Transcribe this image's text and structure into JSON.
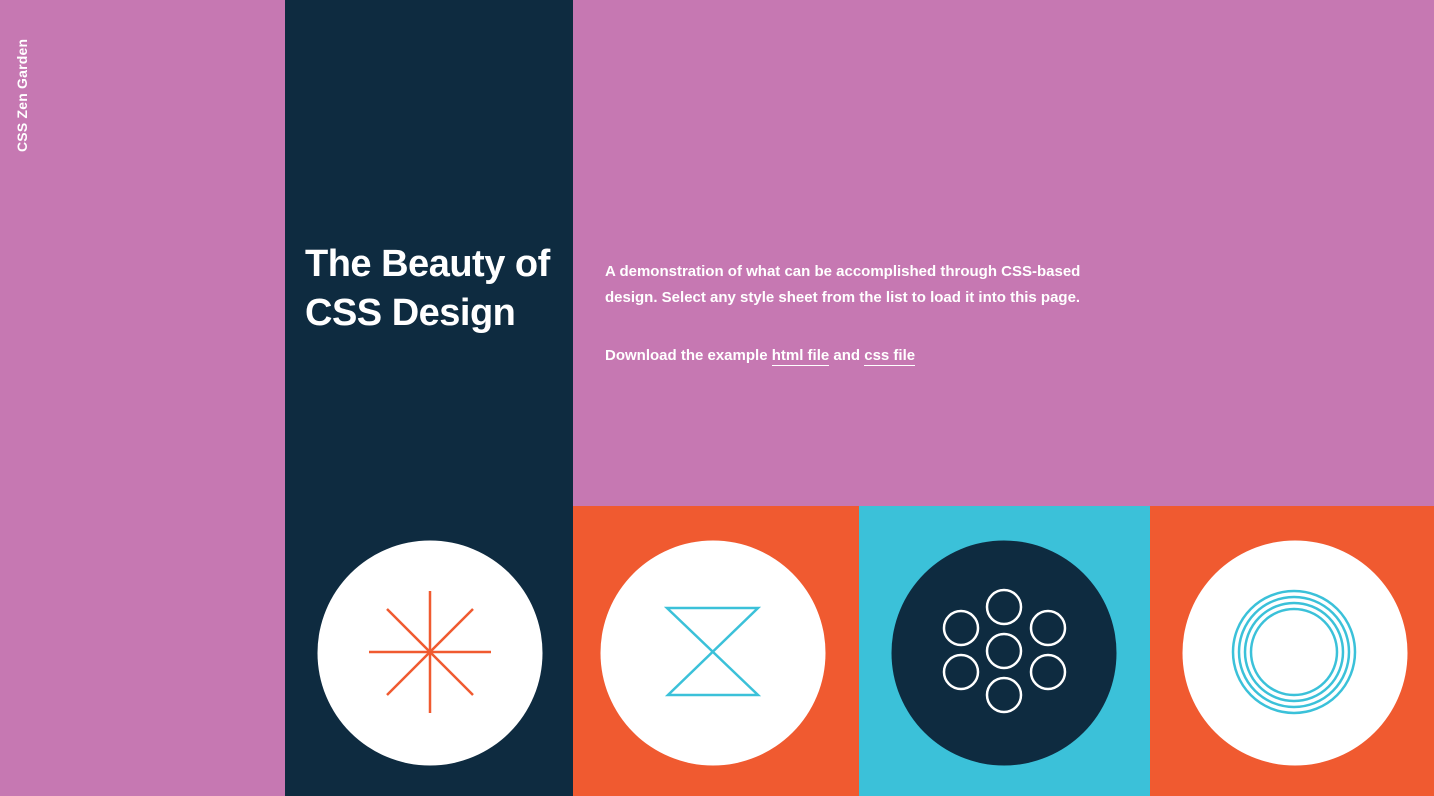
{
  "brand": {
    "name": "CSS Zen Garden"
  },
  "header": {
    "title": "The Beauty of CSS Design"
  },
  "intro": {
    "text": "A demonstration of what can be accomplished through CSS-based design. Select any style sheet from the list to load it into this page.",
    "download_prefix": "Download the example ",
    "html_link": "html file",
    "conjunction": " and ",
    "css_link": "css file"
  },
  "colors": {
    "pink": "#c678b2",
    "navy": "#0e2b40",
    "orange": "#f05a30",
    "cyan": "#3bc1d9",
    "white": "#ffffff"
  },
  "emblems": [
    {
      "name": "asterisk-icon",
      "disc": "white",
      "stroke": "orange"
    },
    {
      "name": "hourglass-icon",
      "disc": "white",
      "stroke": "cyan"
    },
    {
      "name": "circle-cluster-icon",
      "disc": "navy",
      "stroke": "white"
    },
    {
      "name": "concentric-rings-icon",
      "disc": "white",
      "stroke": "cyan"
    }
  ]
}
